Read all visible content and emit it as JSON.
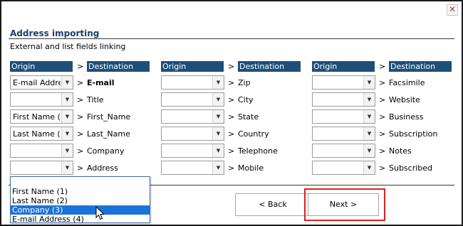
{
  "window": {
    "close_glyph": "✕"
  },
  "header": {
    "title": "Address importing",
    "subtitle": "External and list fields linking"
  },
  "columns": {
    "origin": "Origin",
    "destination": "Destination",
    "arrow": ">"
  },
  "groups": [
    {
      "rows": [
        {
          "origin": "E-mail Addre",
          "destination": "E-mail",
          "bold": true
        },
        {
          "origin": "",
          "destination": "Title"
        },
        {
          "origin": "First Name (1",
          "destination": "First_Name"
        },
        {
          "origin": "Last Name (2",
          "destination": "Last_Name"
        },
        {
          "origin": "",
          "destination": "Company"
        },
        {
          "origin": "",
          "destination": "Address"
        }
      ]
    },
    {
      "rows": [
        {
          "origin": "",
          "destination": "Zip"
        },
        {
          "origin": "",
          "destination": "City"
        },
        {
          "origin": "",
          "destination": "State"
        },
        {
          "origin": "",
          "destination": "Country"
        },
        {
          "origin": "",
          "destination": "Telephone"
        },
        {
          "origin": "",
          "destination": "Mobile"
        }
      ]
    },
    {
      "rows": [
        {
          "origin": "",
          "destination": "Facsimile"
        },
        {
          "origin": "",
          "destination": "Website"
        },
        {
          "origin": "",
          "destination": "Business"
        },
        {
          "origin": "",
          "destination": "Subscription"
        },
        {
          "origin": "",
          "destination": "Notes"
        },
        {
          "origin": "",
          "destination": "Subscribed"
        }
      ]
    }
  ],
  "dropdown": {
    "items": [
      "",
      "First Name (1)",
      "Last Name (2)",
      "Company (3)",
      "E-mail Address (4)"
    ],
    "selected_index": 3
  },
  "buttons": {
    "back": "< Back",
    "next": "Next >"
  },
  "colors": {
    "header_bg": "#1e4f78",
    "selection": "#1a73d9",
    "highlight": "#d9231d"
  }
}
